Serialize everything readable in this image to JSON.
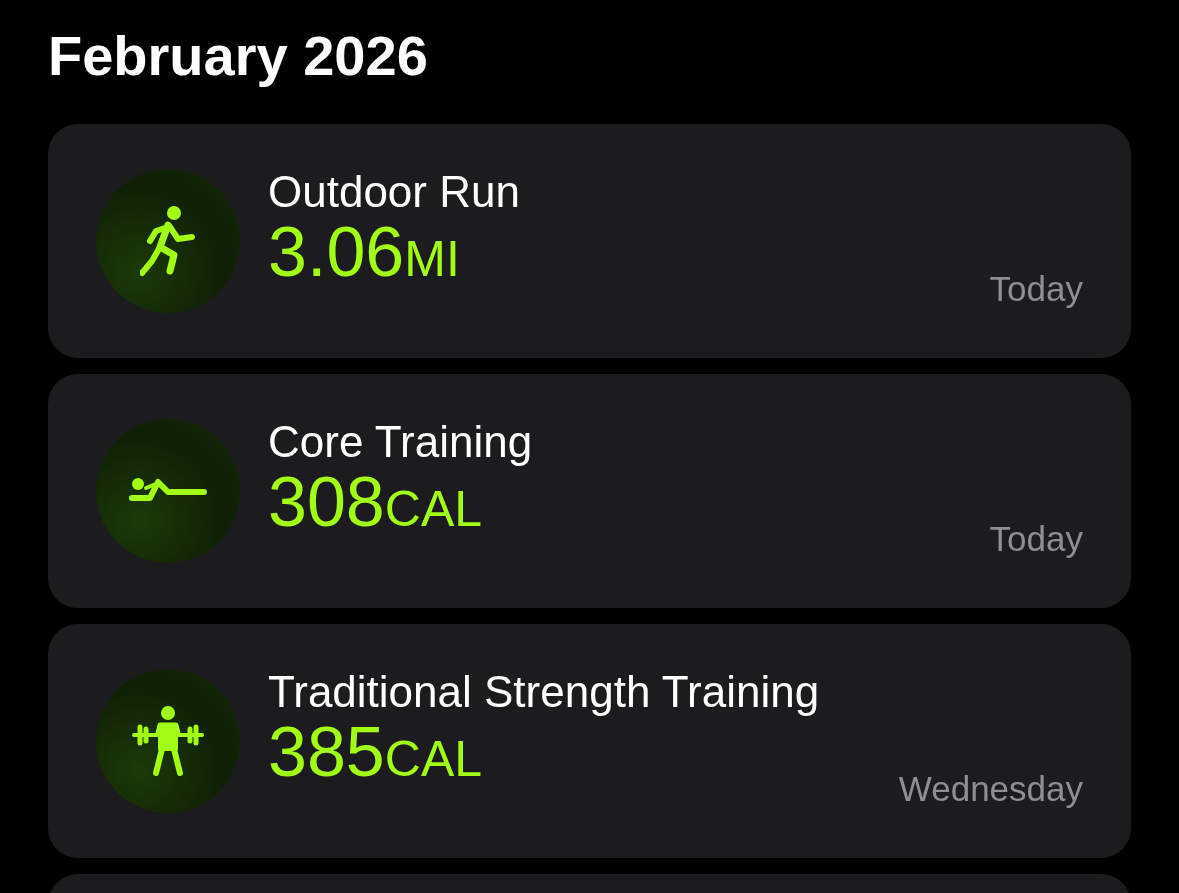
{
  "header": {
    "title": "February 2026"
  },
  "workouts": [
    {
      "kind": "run",
      "name": "Outdoor Run",
      "value": "3.06",
      "unit": "MI",
      "date": "Today"
    },
    {
      "kind": "core",
      "name": "Core Training",
      "value": "308",
      "unit": "CAL",
      "date": "Today"
    },
    {
      "kind": "strength",
      "name": "Traditional Strength Training",
      "value": "385",
      "unit": "CAL",
      "date": "Wednesday"
    }
  ]
}
